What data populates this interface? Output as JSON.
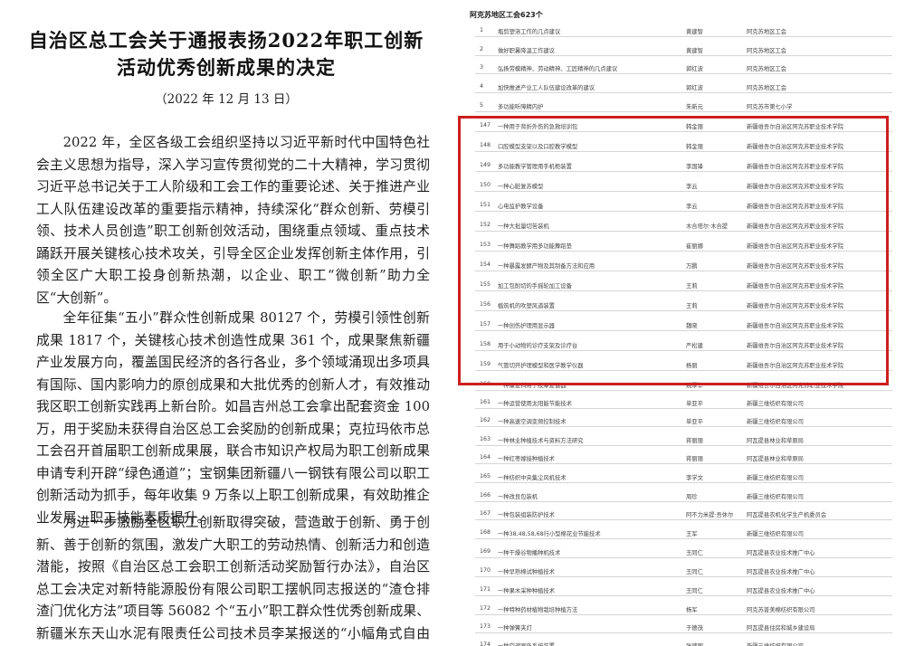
{
  "document": {
    "title_line1": "自治区总工会关于通报表扬2022年职工创新",
    "title_line2": "活动优秀创新成果的决定",
    "date": "（2022 年 12 月 13 日）",
    "paragraphs": [
      "2022 年，全区各级工会组织坚持以习近平新时代中国特色社会主义思想为指导，深入学习宣传贯彻党的二十大精神，学习贯彻习近平总书记关于工人阶级和工会工作的重要论述、关于推进产业工人队伍建设改革的重要指示精神，持续深化“群众创新、劳模引领、技术人员创造”职工创新创效活动，围绕重点领域、重点技术踊跃开展关键核心技术攻关，引导全区企业发挥创新主体作用，引领全区广大职工投身创新热潮，以企业、职工“微创新”助力全区“大创新”。",
      "全年征集“五小”群众性创新成果 80127 个，劳模引领性创新成果 1817 个，关键核心技术创造性成果 361 个，成果聚焦新疆产业发展方向，覆盖国民经济的各行各业，多个领域涌现出多项具有国际、国内影响力的原创成果和大批优秀的创新人才，有效推动我区职工创新实践再上新台阶。如昌吉州总工会拿出配套资金 100 万，用于奖励未获得自治区总工会奖励的创新成果；克拉玛依市总工会召开首届职工创新成果展，联合市知识产权局为职工创新成果申请专利开辟“绿色通道”；宝钢集团新疆八一钢铁有限公司以职工创新活动为抓手，每年收集 9 万条以上职工创新成果，有效助推企业发展、职工技能素质提升。",
      "为进一步激励全区职工创新取得突破，营造敢于创新、勇于创新、善于创新的氛围，激发广大职工的劳动热情、创新活力和创造潜能，按照《自治区总工会职工创新活动奖励暂行办法》，自治区总工会决定对新特能源股份有限公司职工摆帆同志报送的“渣仓排渣门优化方法”项目等 56082 个“五小”职工群众性优秀创新成果、新疆米东天山水泥有限责任公司技术员李某报送的“小幅角式自由流篦式扫灌制作”项目等"
    ]
  },
  "table": {
    "section_title": "阿克苏地区工会623个",
    "rows": [
      {
        "no": "1",
        "title": "瓶剪塑溶工作的几点建议",
        "person": "黄建智",
        "org": "阿克苏地区工会"
      },
      {
        "no": "2",
        "title": "做好职暑降温工作建议",
        "person": "黄建智",
        "org": "阿克苏地区工会"
      },
      {
        "no": "3",
        "title": "弘扬劳模精神、劳动精神、工匠精神的几点建议",
        "person": "郭红波",
        "org": "阿克苏地区工会"
      },
      {
        "no": "4",
        "title": "加快推进产业工人队伍建设改革的建议",
        "person": "郭红波",
        "org": "阿克苏地区工会"
      },
      {
        "no": "5",
        "title": "多功能听障精内护",
        "person": "朱新元",
        "org": "阿克苏市第七小学"
      },
      {
        "no": "147",
        "title": "一种用于背折外伤的急救培训包",
        "person": "韩金丽",
        "org": "新疆维吾尔自治区阿克苏职业技术学院"
      },
      {
        "no": "148",
        "title": "口腔模型支架以及口腔教学模型",
        "person": "韩金丽",
        "org": "新疆维吾尔自治区阿克苏职业技术学院"
      },
      {
        "no": "149",
        "title": "多功能教学管理用手机柜装置",
        "person": "李国锋",
        "org": "新疆维吾尔自治区阿克苏职业技术学院"
      },
      {
        "no": "150",
        "title": "一种心脏复苏模型",
        "person": "李云",
        "org": "新疆维吾尔自治区阿克苏职业技术学院"
      },
      {
        "no": "151",
        "title": "心电监护教学设备",
        "person": "李云",
        "org": "新疆维吾尔自治区阿克苏职业技术学院"
      },
      {
        "no": "152",
        "title": "一种大批量切苦装机",
        "person": "木合塔尔·木合提",
        "org": "新疆维吾尔自治区阿克苏职业技术学院"
      },
      {
        "no": "153",
        "title": "一种舞蹈教学用多功能舞蹈垫",
        "person": "崔丽娜",
        "org": "新疆维吾尔自治区阿克苏职业技术学院"
      },
      {
        "no": "154",
        "title": "一种暴露发酵产物及其制备方法和应用",
        "person": "万鹏",
        "org": "新疆维吾尔自治区阿克苏职业技术学院"
      },
      {
        "no": "155",
        "title": "加工包削切的手摇轮加工设备",
        "person": "王莉",
        "org": "新疆维吾尔自治区阿克苏职业技术学院"
      },
      {
        "no": "156",
        "title": "植筑机的吹塑风道装置",
        "person": "王莉",
        "org": "新疆维吾尔自治区阿克苏职业技术学院"
      },
      {
        "no": "157",
        "title": "一种创伤护理用显示器",
        "person": "魏晓",
        "org": "新疆维吾尔自治区阿克苏职业技术学院"
      },
      {
        "no": "158",
        "title": "用于小动物的诊疗支架及诊疗台",
        "person": "严松建",
        "org": "新疆维吾尔自治区阿克苏职业技术学院"
      },
      {
        "no": "159",
        "title": "气管切开护理模型和医学教学仪器",
        "person": "杨丽",
        "org": "新疆维吾尔自治区阿克苏职业技术学院"
      },
      {
        "no": "160",
        "title": "一种康复科用于按摩复健器",
        "person": "姚厚华",
        "org": "新疆维吾尔自治区阿克苏职业技术学院"
      },
      {
        "no": "161",
        "title": "一种运营使用太阳能节能技术",
        "person": "单亚平",
        "org": "新疆三维纺织有限公司"
      },
      {
        "no": "162",
        "title": "一种高速空调变频控制技术",
        "person": "单亚平",
        "org": "新疆三维纺织有限公司"
      },
      {
        "no": "163",
        "title": "一种林业种植技术与资料方法研究",
        "person": "蒋丽丽",
        "org": "阿瓦提县林业和草原局"
      },
      {
        "no": "164",
        "title": "一种红枣嫁接种植技术",
        "person": "蒋丽丽",
        "org": "阿瓦提县林业和草原局"
      },
      {
        "no": "165",
        "title": "一种纺织中央集尘风机技术",
        "person": "李学文",
        "org": "新疆三维纺织有限公司"
      },
      {
        "no": "166",
        "title": "一种改良包装机",
        "person": "周珍",
        "org": "新疆三维纺织有限公司"
      },
      {
        "no": "167",
        "title": "一种包装组装防护技术",
        "person": "阿不力米提·吾休尔",
        "org": "阿瓦提县农机化学生产机委员会"
      },
      {
        "no": "168",
        "title": "一种38,48,58,68行小型棉花业节能技术",
        "person": "王军",
        "org": "新疆三维纺织有限公司"
      },
      {
        "no": "169",
        "title": "一种干燥谷物播种机技术",
        "person": "王同仁",
        "org": "阿瓦提县农业技术推广中心"
      },
      {
        "no": "170",
        "title": "一种早熟棉试种植技术",
        "person": "王同仁",
        "org": "阿瓦提县农业技术推广中心"
      },
      {
        "no": "171",
        "title": "一种果木采种种植技术",
        "person": "王同仁",
        "org": "阿瓦提县农业技术推广中心"
      },
      {
        "no": "172",
        "title": "一种特种药材植物栽培种植方法",
        "person": "杨军",
        "org": "阿克苏普美棉纺织有限公司"
      },
      {
        "no": "173",
        "title": "一种弹簧夹灯",
        "person": "于德茂",
        "org": "阿瓦提县住房和城乡建设局"
      },
      {
        "no": "174",
        "title": "一种空调室外系统装置",
        "person": "张建国",
        "org": "新疆三维纺织有限公司"
      }
    ]
  }
}
